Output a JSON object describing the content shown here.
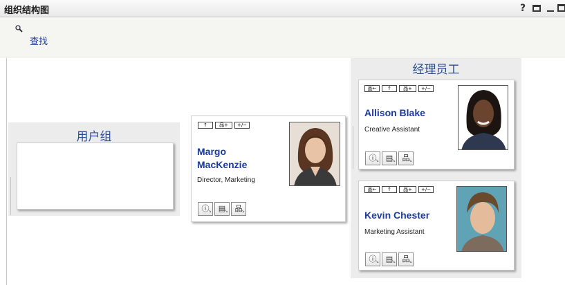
{
  "window": {
    "title": "组织结构图",
    "help": "?",
    "print_icon": "printer-icon",
    "minimize_icon": "minimize-icon",
    "maximize_icon": "maximize-icon"
  },
  "search": {
    "label": "查找",
    "icon": "magnifier-icon"
  },
  "groups": {
    "title": "用户组"
  },
  "manager": {
    "first": "Margo",
    "last": "MacKenzie",
    "title": "Director, Marketing",
    "actions": [
      "↑",
      "品+",
      "+/−"
    ]
  },
  "reports": {
    "title": "经理员工",
    "people": [
      {
        "name": "Allison Blake",
        "title": "Creative Assistant",
        "actions": [
          "品←",
          "↑",
          "品+",
          "+/−"
        ]
      },
      {
        "name": "Kevin Chester",
        "title": "Marketing Assistant",
        "actions": [
          "品←",
          "↑",
          "品+",
          "+/−"
        ]
      }
    ]
  },
  "card_buttons": {
    "info": "ⓘ",
    "message": "▤",
    "org": "品"
  },
  "colors": {
    "link": "#1a3a9f",
    "panel_bg": "#ececec",
    "heading": "#2a4d8f"
  }
}
